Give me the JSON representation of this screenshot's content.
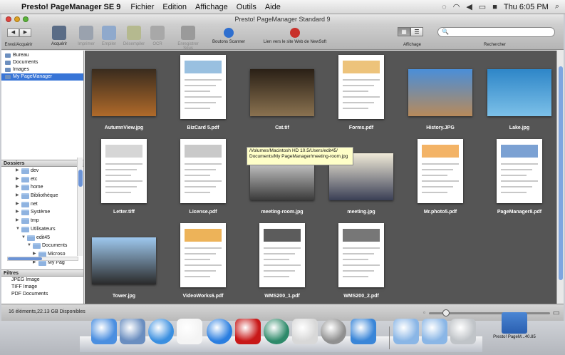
{
  "menubar": {
    "app_name": "Presto! PageManager SE 9",
    "menus": [
      "Fichier",
      "Edition",
      "Affichage",
      "Outils",
      "Aide"
    ],
    "clock": "Thu 6:05 PM"
  },
  "window": {
    "title": "Presto! PageManager Standard 9"
  },
  "toolbar": {
    "nav_back": "◀",
    "nav_forward": "▶",
    "buttons": [
      {
        "label": "Envoi/Acquérir",
        "enabled": true,
        "color": "#4f6d93"
      },
      {
        "label": "Acquérir",
        "enabled": true,
        "color": "#5a6c86"
      },
      {
        "label": "Imprimer",
        "enabled": false,
        "color": "#9aa2ae"
      },
      {
        "label": "Empiler",
        "enabled": false,
        "color": "#8fa9cc"
      },
      {
        "label": "Désempiler",
        "enabled": false,
        "color": "#b5b98f"
      },
      {
        "label": "OCR",
        "enabled": false,
        "color": "#a8a8a8"
      },
      {
        "label": "Enregistrer Sous",
        "enabled": false,
        "color": "#9a9a9a"
      },
      {
        "label": "Boutons Scanner",
        "enabled": true,
        "color": "#2f6fcf"
      },
      {
        "label": "Lien vers le site Web de NewSoft",
        "enabled": true,
        "color": "#c8302a"
      }
    ],
    "view_label": "Affichage",
    "search_label": "Rechercher",
    "search_placeholder": "🔍"
  },
  "sidebar": {
    "sources": [
      {
        "label": "Bureau",
        "selected": false
      },
      {
        "label": "Documents",
        "selected": false
      },
      {
        "label": "Images",
        "selected": false
      },
      {
        "label": "My PageManager",
        "selected": true
      }
    ],
    "folders_header": "Dossiers",
    "tree": [
      {
        "label": "dev",
        "depth": 1,
        "open": false
      },
      {
        "label": "etc",
        "depth": 1,
        "open": false
      },
      {
        "label": "home",
        "depth": 1,
        "open": false
      },
      {
        "label": "Bibliothèque",
        "depth": 1,
        "open": false
      },
      {
        "label": "net",
        "depth": 1,
        "open": false
      },
      {
        "label": "Système",
        "depth": 1,
        "open": false
      },
      {
        "label": "tmp",
        "depth": 1,
        "open": false
      },
      {
        "label": "Utilisateurs",
        "depth": 1,
        "open": true
      },
      {
        "label": "edit45",
        "depth": 2,
        "open": true
      },
      {
        "label": "Documents",
        "depth": 3,
        "open": true
      },
      {
        "label": "Microso",
        "depth": 4,
        "open": false
      },
      {
        "label": "My Pag",
        "depth": 4,
        "open": false
      }
    ],
    "filters_header": "Filtres",
    "filters": [
      "JPEG Image",
      "TIFF Image",
      "PDF Documents"
    ]
  },
  "files": [
    {
      "name": "AutumnView.jpg",
      "kind": "photo",
      "c1": "#3a2c1e",
      "c2": "#b06a2a"
    },
    {
      "name": "BizCard 5.pdf",
      "kind": "doc",
      "c1": "#ffffff",
      "c2": "#7fb0d8"
    },
    {
      "name": "Cat.tif",
      "kind": "photo",
      "c1": "#2a2016",
      "c2": "#8a7250"
    },
    {
      "name": "Forms.pdf",
      "kind": "doc",
      "c1": "#ffffff",
      "c2": "#e9b45a"
    },
    {
      "name": "History.JPG",
      "kind": "photo",
      "c1": "#4a8ed8",
      "c2": "#b88a5a"
    },
    {
      "name": "Lake.jpg",
      "kind": "photo",
      "c1": "#2e86c8",
      "c2": "#7cc0e8"
    },
    {
      "name": "Letter.tiff",
      "kind": "doc",
      "c1": "#ffffff",
      "c2": "#cccccc"
    },
    {
      "name": "License.pdf",
      "kind": "doc",
      "c1": "#ffffff",
      "c2": "#bbbbbb"
    },
    {
      "name": "meeting-room.jpg",
      "kind": "photo",
      "c1": "#e8e8e8",
      "c2": "#3a3a3a"
    },
    {
      "name": "meeting.jpg",
      "kind": "photo",
      "c1": "#f0ead8",
      "c2": "#3a3f55"
    },
    {
      "name": "Mr.photo5.pdf",
      "kind": "doc",
      "c1": "#ffffff",
      "c2": "#f0a040"
    },
    {
      "name": "PageManager8.pdf",
      "kind": "doc",
      "c1": "#ffffff",
      "c2": "#5a8ac8"
    },
    {
      "name": "Tower.jpg",
      "kind": "photo",
      "c1": "#9ec8ee",
      "c2": "#2a2a2a"
    },
    {
      "name": "VideoWorks6.pdf",
      "kind": "doc",
      "c1": "#ffffff",
      "c2": "#e8a030"
    },
    {
      "name": "WMS200_1.pdf",
      "kind": "doc",
      "c1": "#ffffff",
      "c2": "#333333"
    },
    {
      "name": "WMS200_2.pdf",
      "kind": "doc",
      "c1": "#ffffff",
      "c2": "#555555"
    }
  ],
  "tooltip": "/Volumes/Macintosh HD 10.5/Users/edit45/ Documents/My PageManager/meeting-room.jpg",
  "status": {
    "count": "16 éléments,22.13 GB Disponibles",
    "zoom_level": 0.12
  },
  "dock": [
    {
      "name": "finder-icon",
      "color": "#4b8fe0"
    },
    {
      "name": "preview-icon",
      "color": "#6a8ec0"
    },
    {
      "name": "safari-icon",
      "color": "#3a8fe0"
    },
    {
      "name": "ical-icon",
      "color": "#f4f4f4"
    },
    {
      "name": "itunes-icon",
      "color": "#2a7ee0"
    },
    {
      "name": "photo-booth-icon",
      "color": "#c81818"
    },
    {
      "name": "time-machine-icon",
      "color": "#2e8a6a"
    },
    {
      "name": "x11-icon",
      "color": "#d8d8d8"
    },
    {
      "name": "system-preferences-icon",
      "color": "#909090"
    },
    {
      "name": "app-store-icon",
      "color": "#3a86d8"
    },
    {
      "name": "documents-stack-icon",
      "color": "#8ab6e6"
    },
    {
      "name": "downloads-stack-icon",
      "color": "#8ab6e6"
    },
    {
      "name": "trash-icon",
      "color": "#c0c4c8"
    }
  ],
  "desktop_icon": {
    "label": "Presto! PageM...40.85"
  }
}
